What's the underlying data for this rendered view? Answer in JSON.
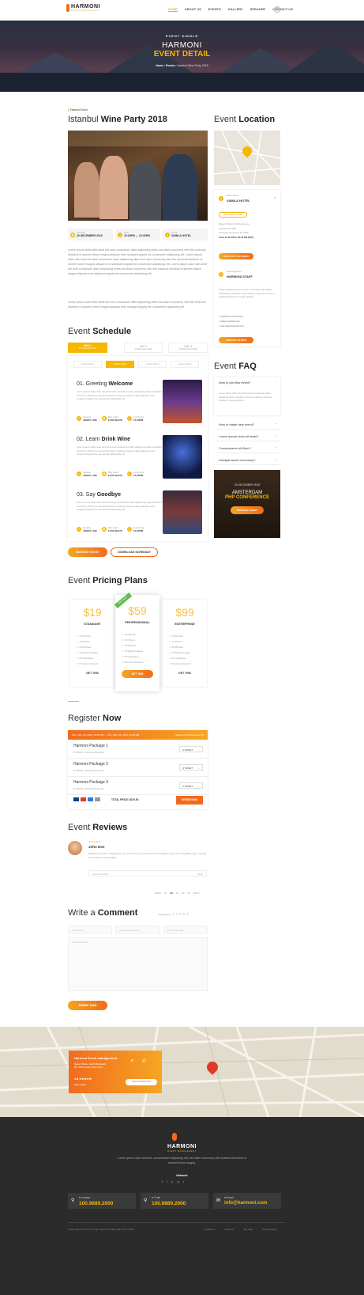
{
  "brand": {
    "name": "HARMONI",
    "tag": "EVENT MANAGEMENT"
  },
  "nav": [
    "HOME",
    "ABOUT US",
    "EVENTS",
    "GALLERY",
    "SPEAKER",
    "CONTACT US"
  ],
  "hero": {
    "kicker": "EVENT SINGLE",
    "line1": "HARMONI",
    "line2": "EVENT DETAIL",
    "crumbs": [
      "Home",
      "Events",
      "Istanbul Wine Party 2018"
    ]
  },
  "featured": "Featured Event",
  "event": {
    "title_light": "Istanbul",
    "title_bold": "Wine Party 2018",
    "date_lbl": "The Date",
    "date": "26 DECEMBER 2018",
    "time_lbl": "Time",
    "time": "15:30PM — 22:30PM",
    "venue_lbl": "Venue",
    "venue": "VAMILA HOTEL"
  },
  "about": [
    "Lorem ipsum dolor sitte amet the best consectuer diam adipiscing elites sed diam nonummy nibh the euismod tincidunt ut laoreet dolore magna aliquam erat volutpat insignia the consectuer adipiscing elit. Lorem ipsum dolor site amet the best consectuer diam adipiscing elites sed diam nonummy nibh the euismod tincidunt ut laoreet dolore magna aliquam erat volutpat insignia the consectuer adipiscing elit. Lorem ipsum dolor site amet the best consectuer diam adipiscing elites sed diam nonummy nibh the euismod tincidunt ut laoreet dolore magna aliquam erat volutpat insignia the consectuer adipiscing elit.",
    "Lorem ipsum dolor sitte amet the best consectuer diam adipiscing elites sed diam nonummy nibh the euismod tincidunt ut laoreet dolore magna aliquam erat volutpat insignia the consectuer adipiscing elit."
  ],
  "location": {
    "title_light": "Event",
    "title_bold": "Location",
    "venue_lbl": "Event Venue",
    "venue": "VAMILA HOTEL",
    "btn1": "GET DIRECTIONS",
    "addr": [
      "Regent Plaza & Mobile Square",
      "Istanbul, BC 3287",
      "Thursday, December 26, 2018",
      "From 15:30 PM to 20:30 PM (EST)"
    ],
    "btn2": "ADD TO MY CALENDAR",
    "org_lbl": "Event Organizer",
    "org": "HARMONI STAFF",
    "org_text": "Fusce pellentesque dui neque, consectetur eget ligula. Pellentesque habitant morbi tristique senectus et netus et malesuada fames ac turpis egestas.",
    "links": [
      "facebook.com/harmoni",
      "twitter.com/harmoni",
      "http://www.harmoni.com"
    ],
    "btn3": "CONTACT US NOW"
  },
  "faq": {
    "title_light": "Event",
    "title_bold": "FAQ",
    "open_q": "How to join this event?",
    "open_a": "Lorem ipsum dolor sit amet the best consectuer diam adipiscing elites sed diam nonummy nibh the euismod tincidunt ut laoreet dolore.",
    "items": [
      "How to make new event?",
      "Lorem ipsum dolor sit amet?",
      "Consectuerer sit illum?",
      "Volutpat laoret nonummy?"
    ]
  },
  "promo": {
    "date": "26 DECEMBER 2018",
    "city": "AMSTERDAM",
    "name": "PHP CONFERENCE",
    "btn": "BOOKING TICKET"
  },
  "schedule": {
    "title_light": "Event",
    "title_bold": "Schedule",
    "days": [
      {
        "l": "DAY 1",
        "d": "26 December 2018"
      },
      {
        "l": "DAY 2",
        "d": "27 December 2018"
      },
      {
        "l": "DAY 3",
        "d": "28 December 2018"
      }
    ],
    "halls": [
      "Grand Hall 1",
      "Grand Hall 2",
      "Grand Hall 3",
      "Grand Hall 4"
    ],
    "items": [
      {
        "n": "01. Greeting",
        "b": "Welcome"
      },
      {
        "n": "02. Learn",
        "b": "Drink Wine"
      },
      {
        "n": "03. Say",
        "b": "Goodbye"
      }
    ],
    "lorem": "Lorem ipsum dolor sitte amet the best consectuer diam adipiscing elites sed diam nonummy nibh the euismod tincidunt ut laoreet dolore magna aliquam erat volutpat insignia the consectuer adipiscing elit.",
    "speaker_lbl": "Speaker",
    "speaker": "JOHNY LISE",
    "seat_lbl": "Max seats",
    "seat": "2,350 SEATS",
    "time_lbl": "Lunch time",
    "time": "15:30PM"
  },
  "booking": {
    "btn1": "BOOKING TICKET",
    "btn2": "DOWNLOAD SCHEDULE"
  },
  "pricing": {
    "title_light": "Event",
    "title_bold": "Pricing Plans",
    "badge": "Best choice",
    "plans": [
      {
        "p": "$19",
        "n": "STANDART",
        "b": "GET THIS"
      },
      {
        "p": "$59",
        "n": "PROFESSIONAL",
        "b": "GET THIS"
      },
      {
        "p": "$99",
        "n": "ENTERPRISE",
        "b": "GET THIS"
      }
    ],
    "features": [
      "1-5 Person",
      "1-5 Photo",
      "25 Minutes",
      "10 Stylish Images",
      "Print Release",
      "Premium Retouch"
    ]
  },
  "register": {
    "title_light": "Register",
    "title_bold": "Now",
    "bar_l": "Sun, DEC 26, 2018, 15:30 PM — Thu, DEC 28, 2018, 22:30 PM",
    "bar_r": "Event end in December 28",
    "pkgs": [
      {
        "t": "Harmoni Package 1",
        "d": "$ 135.00  +  $ 8.99 service fee"
      },
      {
        "t": "Harmoni Package 2",
        "d": "$ 135.00  +  $ 8.99 service fee"
      },
      {
        "t": "Harmoni Package 3",
        "d": "$ 135.00  +  $ 8.99 service fee"
      }
    ],
    "qty": "0 TICKET",
    "total": "TOTAL PRICE: $376.90",
    "btn": "ORDER NOW"
  },
  "reviews": {
    "title_light": "Event",
    "title_bold": "Reviews",
    "name": "John Doe",
    "stars": "★★★★★",
    "text": "Brilliant production. Enjoyed the mix of old and new, emotional and heartfelt. Jenny has incredible voice. I felt the performance was beautiful.",
    "meta": "August 28 2018",
    "share": "Reply",
    "pager": [
      "PREV",
      "01",
      "02",
      "03",
      "04",
      "05",
      "NEXT"
    ]
  },
  "comment": {
    "title_light": "Write a",
    "title_bold": "Comment",
    "rate": "Your Rating:",
    "name": "Your Name",
    "email": "Your Email Address",
    "phone": "Phone Number",
    "msg": "Your Comment",
    "btn": "SUBMIT NOW"
  },
  "mapcard": {
    "title": "Harmoni Event management",
    "addr": "Regent Plaza, 1st/2/4 Boulevard\n88 / 2500 Istanbul Deo Street",
    "rating": "4.8",
    "reviews": "188 reviews",
    "btn": "VIEW LARGER MAP"
  },
  "footer": {
    "text": "Lorem ipsum dolor sit amet, consectetuer adipiscing elit, sed diam nonummy nibh euismod tincidunt ut laoreet dolore magna.",
    "network": "Network",
    "boxes": [
      {
        "l": "London",
        "v": "100.9889.2000"
      },
      {
        "l": "Tunis",
        "v": "100.9889.2000"
      },
      {
        "l": "Email",
        "v": "info@harmoni.com"
      }
    ],
    "copy": "©2019 Harmoni.com. All right reserved. Made with ♥ by LouJar",
    "links": [
      "Contact us",
      "About us",
      "Site Map",
      "Privacy policy"
    ]
  }
}
